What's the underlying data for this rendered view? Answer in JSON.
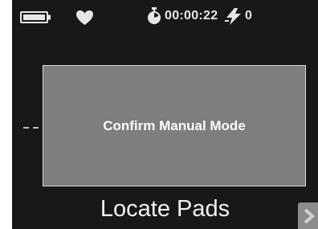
{
  "status_bar": {
    "battery_icon": "battery-icon",
    "heart_icon": "heart-icon",
    "stopwatch_icon": "stopwatch-icon",
    "elapsed_time": "00:00:22",
    "shock_icon": "lightning-bolt-icon",
    "shock_count": "0"
  },
  "dialog": {
    "message": "Confirm Manual Mode"
  },
  "prompt": {
    "text": "Locate Pads"
  },
  "next_button": {
    "icon": "chevron-right-icon"
  },
  "colors": {
    "screen_background": "#181818",
    "dialog_background": "#7e7e7e",
    "dialog_border": "#d8d8d8",
    "text": "#ffffff"
  }
}
